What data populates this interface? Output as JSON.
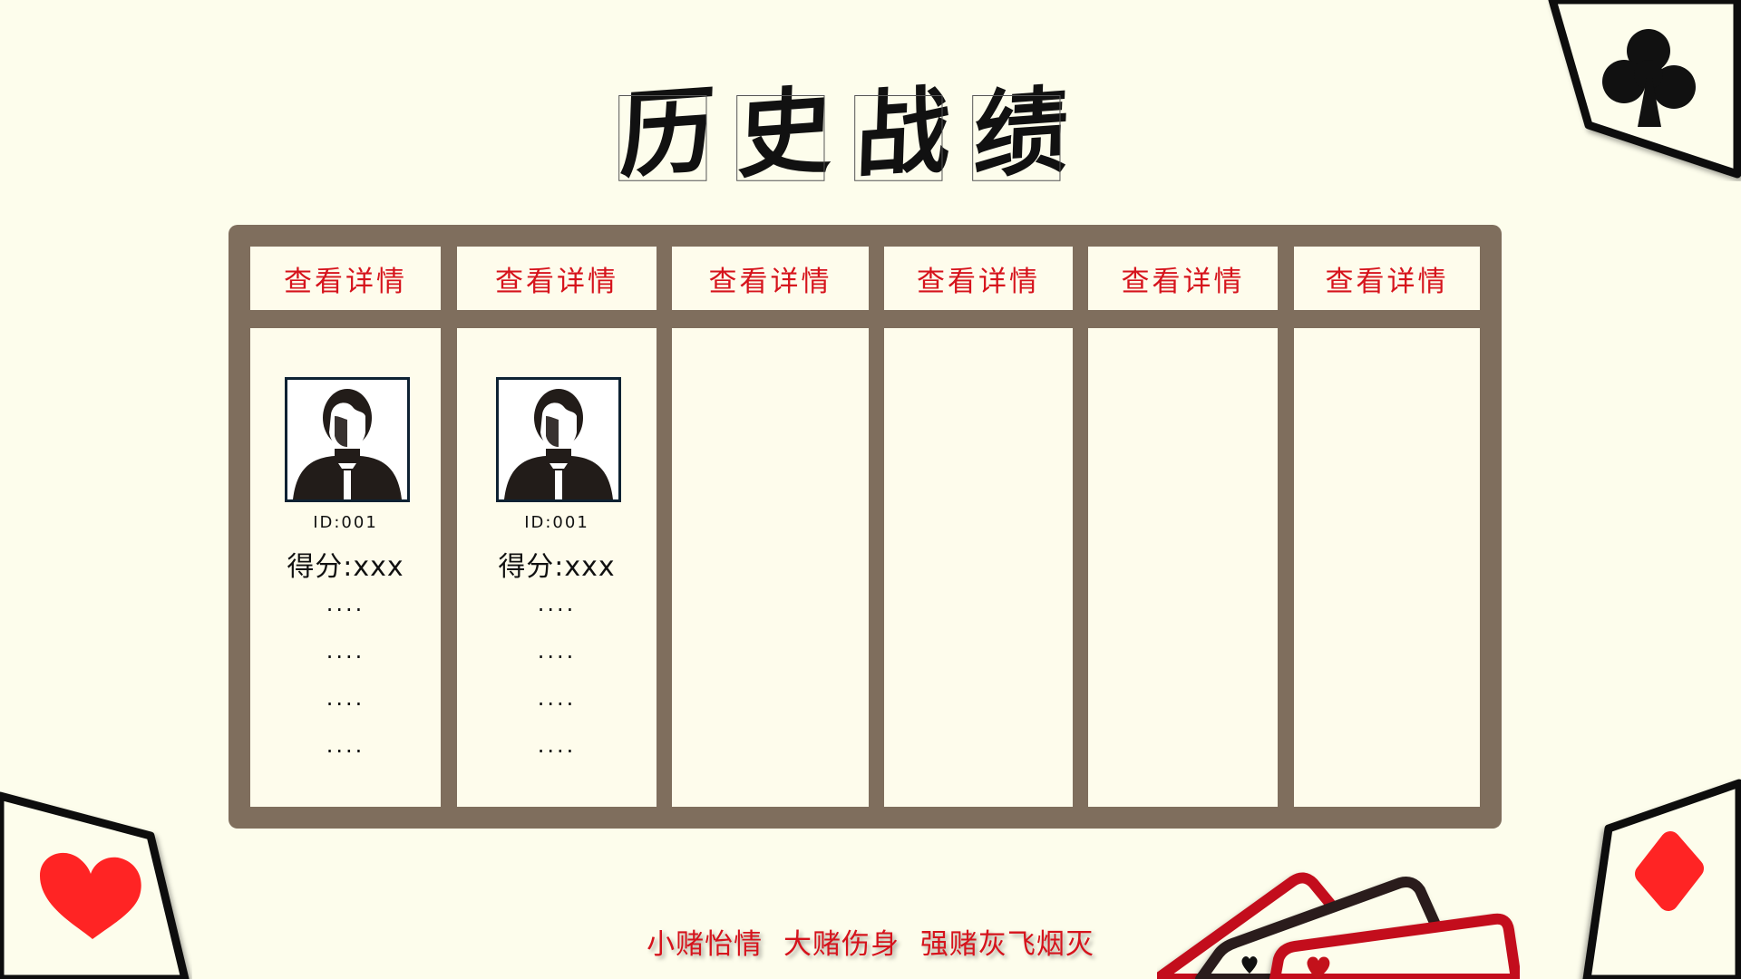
{
  "page": {
    "title_chars": [
      "历",
      "史",
      "战",
      "绩"
    ]
  },
  "columns": [
    {
      "header": "查看详情",
      "player": {
        "id": "ID:001",
        "score": "得分:xxx",
        "lines": [
          "....",
          "....",
          "....",
          "...."
        ]
      }
    },
    {
      "header": "查看详情",
      "player": {
        "id": "ID:001",
        "score": "得分:xxx",
        "lines": [
          "....",
          "....",
          "....",
          "...."
        ]
      }
    },
    {
      "header": "查看详情"
    },
    {
      "header": "查看详情"
    },
    {
      "header": "查看详情"
    },
    {
      "header": "查看详情"
    }
  ],
  "slogan": [
    "小赌怡情",
    "大赌伤身",
    "强赌灰飞烟灭"
  ],
  "decorations": {
    "suits": [
      "club-card",
      "heart-card",
      "diamond-card",
      "card-fan"
    ]
  },
  "colors": {
    "background": "#fdfdec",
    "board": "#7f6e5d",
    "accent_red": "#d6131c",
    "heart_red": "#ff2424"
  }
}
